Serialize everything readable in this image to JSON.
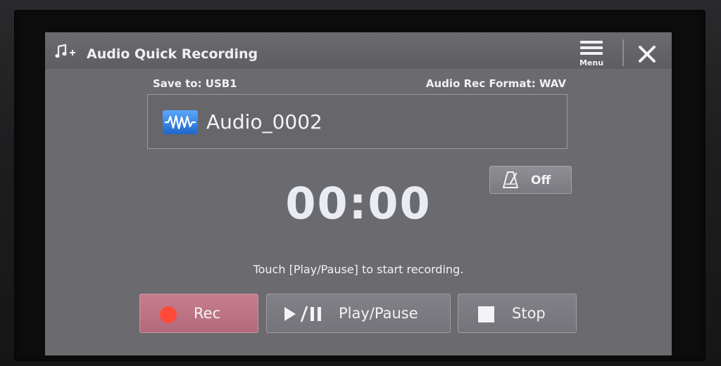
{
  "window": {
    "title": "Audio Quick Recording",
    "title_icon": "music-note-plus-icon",
    "menu_label": "Menu",
    "menu_icon": "hamburger-menu-icon",
    "close_icon": "close-icon"
  },
  "recording": {
    "save_to": "Save to: USB1",
    "format": "Audio Rec Format: WAV",
    "file_icon": "audio-waveform-icon",
    "file_name": "Audio_0002",
    "metronome_icon": "metronome-icon",
    "metronome_state": "Off",
    "elapsed_time": "00:00",
    "hint": "Touch [Play/Pause] to start recording."
  },
  "controls": {
    "rec_label": "Rec",
    "play_pause_label": "Play/Pause",
    "stop_label": "Stop"
  },
  "colors": {
    "screen_bg": "#6a6a6f",
    "rec_button": "#c67e8e",
    "rec_dot": "#ff4a3a",
    "file_icon_blue": "#2f7fe3"
  }
}
